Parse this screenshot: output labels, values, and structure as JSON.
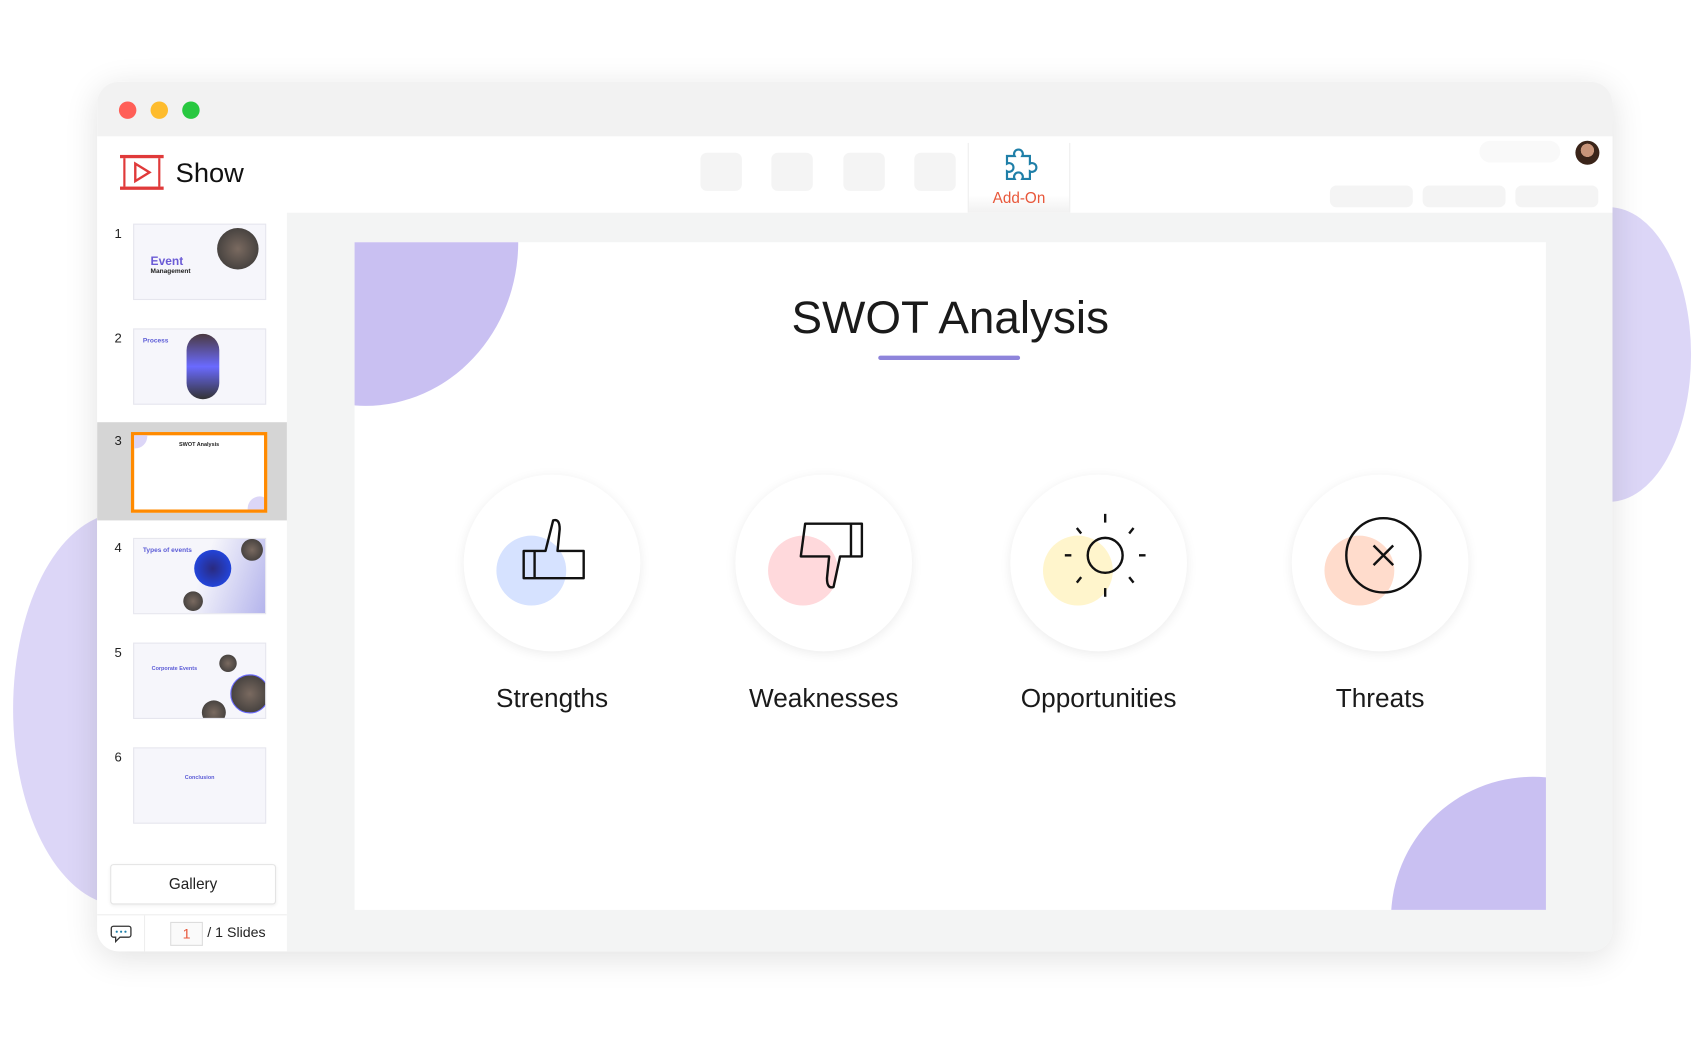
{
  "window": {
    "controls": [
      "close",
      "minimize",
      "maximize"
    ],
    "colors": {
      "close": "#ff5f57",
      "minimize": "#febc2e",
      "maximize": "#28c840"
    }
  },
  "app": {
    "name": "Show",
    "brand_color": "#e03a3a"
  },
  "toolbar": {
    "addon_label": "Add-On",
    "addon_icon": "puzzle-icon"
  },
  "sidebar": {
    "slides": [
      {
        "number": "1",
        "title": "Event",
        "subtitle": "Management"
      },
      {
        "number": "2",
        "title": "Process"
      },
      {
        "number": "3",
        "title": "SWOT Analysis",
        "selected": true
      },
      {
        "number": "4",
        "title": "Types of events"
      },
      {
        "number": "5",
        "title": "Corporate Events"
      },
      {
        "number": "6",
        "title": "Conclusion"
      }
    ],
    "gallery_label": "Gallery",
    "current_page": "1",
    "total_label": "/ 1 Slides"
  },
  "slide": {
    "title": "SWOT Analysis",
    "accent": "#8e84db",
    "items": [
      {
        "label": "Strengths",
        "icon": "thumbs-up-icon",
        "color": "#d6e2ff"
      },
      {
        "label": "Weaknesses",
        "icon": "thumbs-down-icon",
        "color": "#ffd9dc"
      },
      {
        "label": "Opportunities",
        "icon": "sun-icon",
        "color": "#fff5cc"
      },
      {
        "label": "Threats",
        "icon": "close-circle-icon",
        "color": "#ffdccc"
      }
    ]
  }
}
